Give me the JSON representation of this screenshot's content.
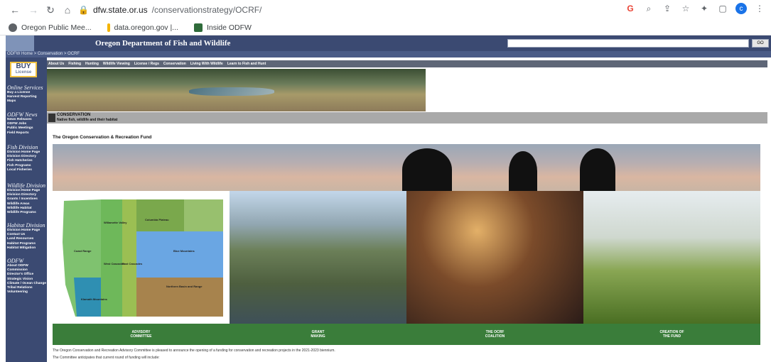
{
  "browser": {
    "url_host": "dfw.state.or.us",
    "url_path": "/conservationstrategy/OCRF/",
    "bookmarks": [
      "Oregon Public Mee...",
      "data.oregon.gov |...",
      "Inside ODFW"
    ],
    "avatar_initial": "c"
  },
  "site": {
    "title": "Oregon Department of Fish and Wildlife",
    "breadcrumb": "ODFW Home > Conservation > OCRF",
    "search_button": "GO"
  },
  "sidebar": {
    "buy": {
      "title": "BUY",
      "sub": "License"
    },
    "sections": [
      {
        "heading": "Online Services",
        "items": [
          "Buy a License",
          "Harvest Reporting",
          "Maps"
        ]
      },
      {
        "heading": "ODFW News",
        "items": [
          "News Releases",
          "ODFW Jobs",
          "Public Meetings",
          "Field Reports"
        ]
      },
      {
        "heading": "Fish Division",
        "items": [
          "Division Home Page",
          "Division Directory",
          "Fish Hatcheries",
          "Fish Programs",
          "Local Fisheries"
        ]
      },
      {
        "heading": "Wildlife Division",
        "items": [
          "Division Home Page",
          "Division Directory",
          "Grants / Incentives",
          "Wildlife Areas",
          "Wildlife Habitat",
          "Wildlife Programs"
        ]
      },
      {
        "heading": "Habitat Division",
        "items": [
          "Division Home Page",
          "Contact Us",
          "Land Resources",
          "Habitat Programs",
          "Habitat Mitigation"
        ]
      },
      {
        "heading": "ODFW",
        "items": [
          "About ODFW",
          "Commission",
          "Director's Office",
          "Strategic Vision",
          "Climate / Ocean Change",
          "Tribal Relations",
          "Volunteering"
        ]
      }
    ]
  },
  "topnav": [
    "About Us",
    "Fishing",
    "Hunting",
    "Wildlife Viewing",
    "License / Regs",
    "Conservation",
    "Living With Wildlife",
    "Learn to Fish and Hunt"
  ],
  "conservation": {
    "title": "CONSERVATION",
    "subtitle": "Native fish, wildlife and their habitat"
  },
  "page": {
    "heading": "The Oregon Conservation & Recreation Fund",
    "tiles_map_labels": [
      "Willamette Valley",
      "Coast Range",
      "West Cascades",
      "East Cascades",
      "Blue Mountains",
      "Columbia Plateau",
      "Klamath Mountains",
      "Northern Basin and Range"
    ]
  },
  "green_nav": [
    "ADVISORY\nCOMMITTEE",
    "GRANT\nMAKING",
    "THE OCRF\nCOALITION",
    "CREATION OF\nTHE FUND"
  ],
  "paragraphs": [
    "The Oregon Conservation and Recreation Advisory Committee is pleased to announce the opening of a funding for conservation and recreation projects in the 2021-2023 biennium.",
    "The Committee anticipates that current round of funding will include:"
  ],
  "colors": {
    "header_blue": "#3b4a72",
    "nav_gray": "#5e6677",
    "green": "#3a7d3a",
    "conservation_gray": "#a9a9a9"
  }
}
